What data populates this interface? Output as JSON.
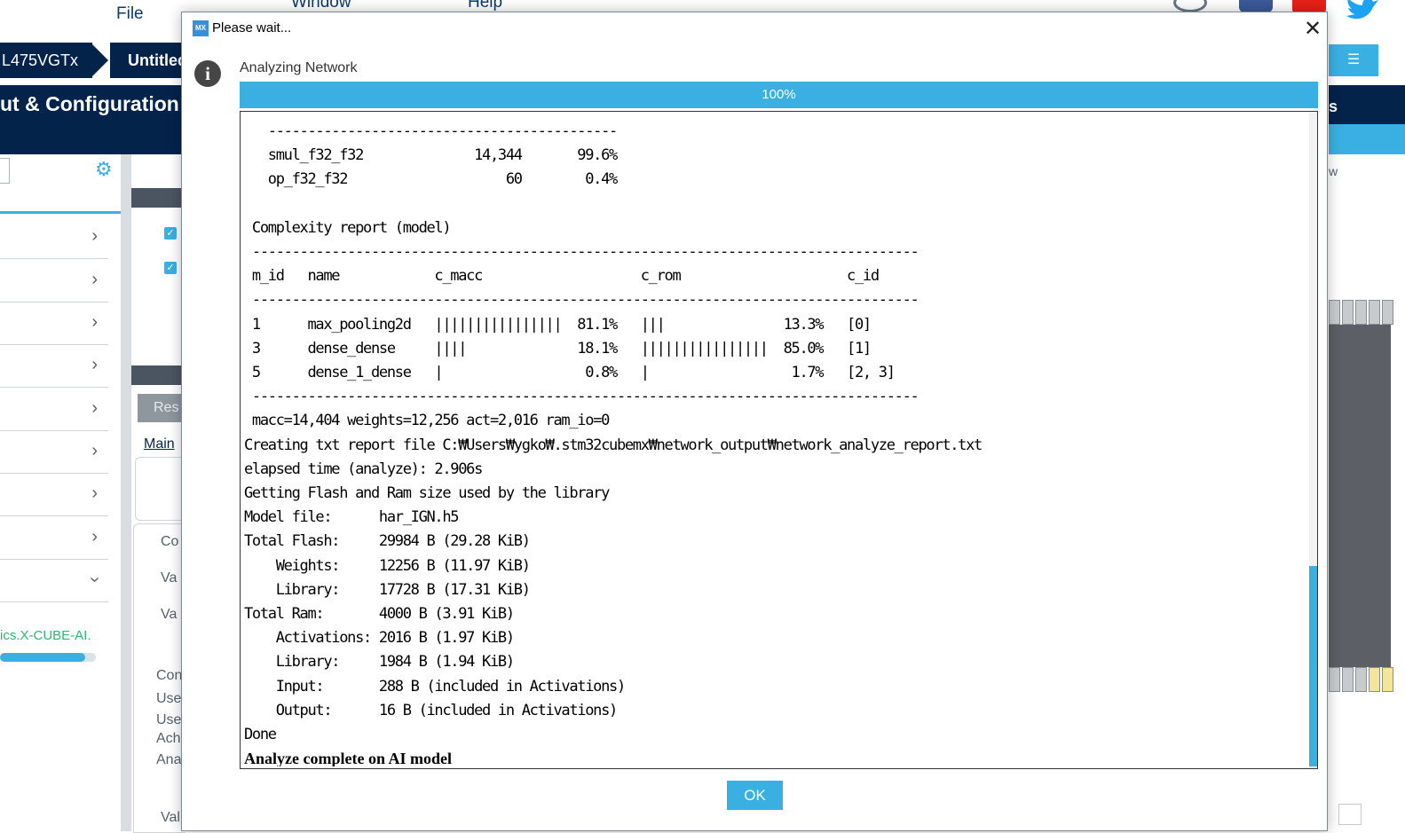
{
  "app": {
    "menu": [
      "File",
      "Window",
      "Help"
    ],
    "breadcrumb": [
      "L475VGTx",
      "Untitled"
    ],
    "header_title": "ut & Configuration",
    "side_link": "ics.X-CUBE-AI.",
    "reset_button": "Res",
    "main_tab": "Main",
    "mid_labels": [
      "Co",
      "Va",
      "Va",
      "Con",
      "Use",
      "Use",
      "Ach",
      "Ana",
      "Val"
    ],
    "right_partial": [
      "s",
      "w"
    ],
    "progress_fraction": 0.88
  },
  "dialog": {
    "title": "Please wait...",
    "status": "Analyzing Network",
    "progress_label": "100%",
    "progress_value": 1.0,
    "ok_label": "OK",
    "log_lines": [
      "   --------------------------------------------",
      "   smul_f32_f32              14,344       99.6%",
      "   op_f32_f32                    60        0.4%",
      "",
      " Complexity report (model)",
      " ------------------------------------------------------------------------------------",
      " m_id   name            c_macc                    c_rom                     c_id",
      " ------------------------------------------------------------------------------------",
      " 1      max_pooling2d   ||||||||||||||||  81.1%   |||               13.3%   [0]",
      " 3      dense_dense     ||||              18.1%   ||||||||||||||||  85.0%   [1]",
      " 5      dense_1_dense   |                  0.8%   |                  1.7%   [2, 3]",
      " ------------------------------------------------------------------------------------",
      " macc=14,404 weights=12,256 act=2,016 ram_io=0",
      "Creating txt report file C:₩Users₩ygko₩.stm32cubemx₩network_output₩network_analyze_report.txt",
      "elapsed time (analyze): 2.906s",
      "Getting Flash and Ram size used by the library",
      "Model file:      har_IGN.h5",
      "Total Flash:     29984 B (29.28 KiB)",
      "    Weights:     12256 B (11.97 KiB)",
      "    Library:     17728 B (17.31 KiB)",
      "Total Ram:       4000 B (3.91 KiB)",
      "    Activations: 2016 B (1.97 KiB)",
      "    Library:     1984 B (1.94 KiB)",
      "    Input:       288 B (included in Activations)",
      "    Output:      16 B (included in Activations)",
      "Done"
    ],
    "log_final": "Analyze complete on AI model"
  }
}
